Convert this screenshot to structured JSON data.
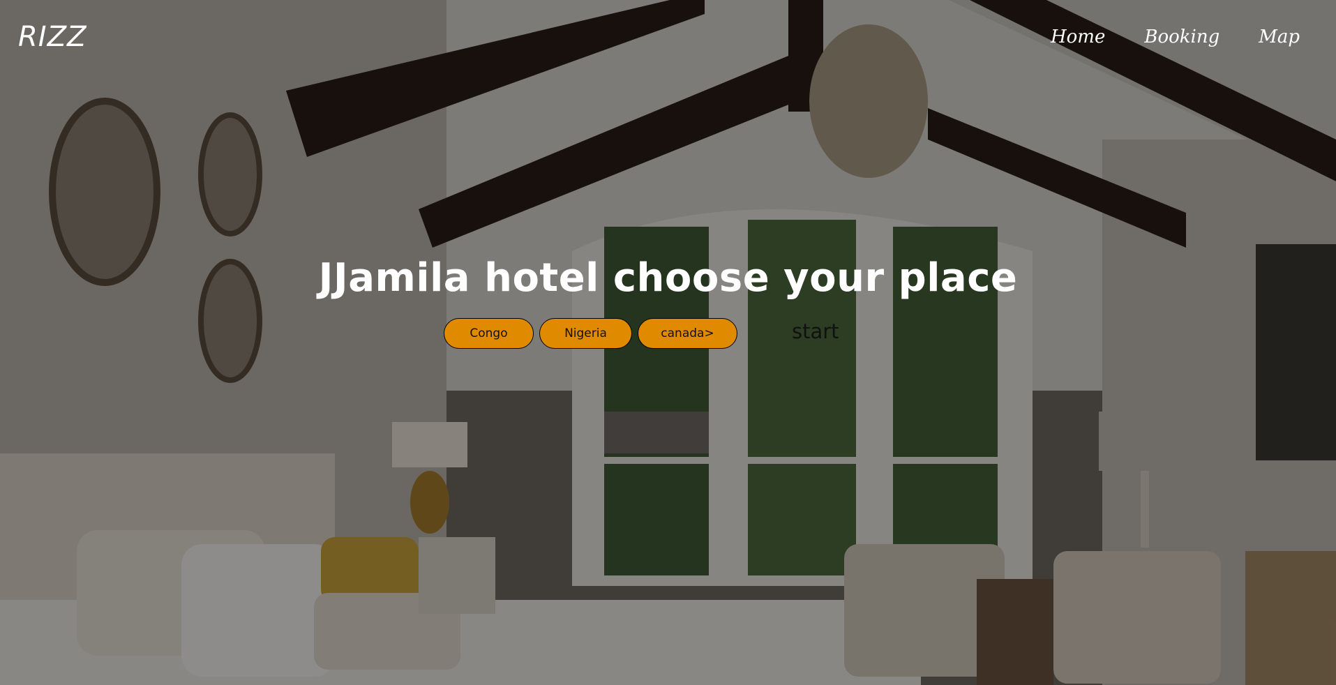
{
  "brand": {
    "logo": "RIZZ"
  },
  "nav": {
    "items": [
      {
        "label": "Home"
      },
      {
        "label": "Booking"
      },
      {
        "label": "Map"
      }
    ]
  },
  "hero": {
    "headline": "JJamila hotel choose your place",
    "buttons": [
      {
        "label": "Congo"
      },
      {
        "label": "Nigeria"
      },
      {
        "label": "canada>"
      }
    ],
    "start_label": "start"
  },
  "colors": {
    "button_bg": "#e08a00",
    "text": "#ffffff",
    "overlay": "rgba(0,0,0,0.42)"
  },
  "icons": []
}
